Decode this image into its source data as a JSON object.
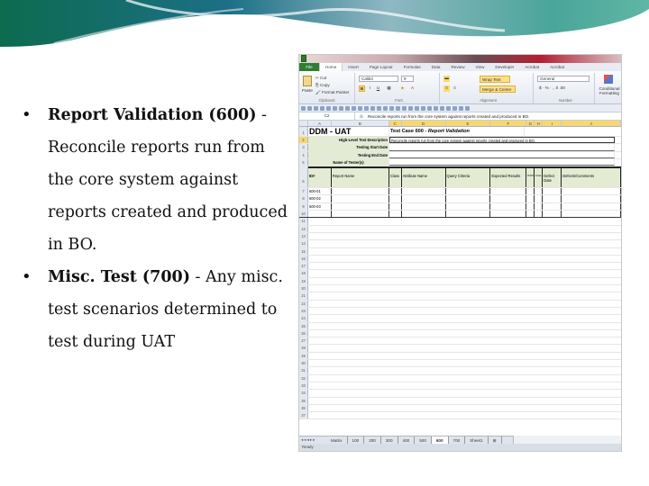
{
  "slide": {
    "bullets": [
      {
        "bold": "Report Validation (600)",
        "text": " - Reconcile reports run from the core system against reports created and produced in BO."
      },
      {
        "bold": "Misc. Test (700)",
        "text": " - Any misc. test scenarios determined to test during UAT"
      }
    ]
  },
  "excel": {
    "ribbon_tabs": [
      "File",
      "Home",
      "Insert",
      "Page Layout",
      "Formulas",
      "Data",
      "Review",
      "View",
      "Developer",
      "Acrobat",
      "Acrobat"
    ],
    "active_tab": "Home",
    "clipboard": {
      "paste": "Paste",
      "cut": "Cut",
      "copy": "Copy",
      "format_painter": "Format Painter",
      "group": "Clipboard"
    },
    "font": {
      "name": "Calibri",
      "size": "9",
      "bold": "B",
      "italic": "I",
      "underline": "U",
      "group": "Font"
    },
    "alignment": {
      "wrap_text": "Wrap Text",
      "merge_center": "Merge & Center",
      "group": "Alignment"
    },
    "number": {
      "format": "General",
      "group": "Number"
    },
    "styles": {
      "conditional_formatting": "Conditional Formatting"
    },
    "name_box": "C2",
    "fx": "fx",
    "formula": "Reconcile reports run from the core system against reports created and produced in BO.",
    "columns": [
      "A",
      "B",
      "C",
      "D",
      "E",
      "F",
      "G",
      "H",
      "I",
      "J"
    ],
    "selected_column": "C",
    "sheet": {
      "title": "DDM - UAT",
      "test_case": "Test Case 600 - ",
      "test_case_italic": "Report Validation",
      "fields": [
        {
          "label": "High-Level Test Description",
          "value": "Reconcile reports run from the core system against reports created and produced in BO."
        },
        {
          "label": "Testing Start Date",
          "value": ""
        },
        {
          "label": "Testing End Date",
          "value": ""
        },
        {
          "label": "Name of Tester(s)",
          "value": ""
        }
      ],
      "headers": [
        "ID#",
        "Report Name",
        "Class",
        "Attribute Name",
        "Query Criteria",
        "Expected Results",
        "PASS",
        "FAIL",
        "Defect Date",
        "Defects/Comments"
      ],
      "ids": [
        "600-01",
        "600-02",
        "600-03"
      ],
      "row_numbers": [
        "1",
        "2",
        "3",
        "4",
        "5",
        "6",
        "7",
        "8",
        "9",
        "10",
        "11",
        "12",
        "13",
        "14",
        "15",
        "16",
        "17",
        "18",
        "19",
        "20",
        "21",
        "22",
        "23",
        "24",
        "25",
        "26",
        "27",
        "28",
        "29",
        "30",
        "31",
        "32",
        "33",
        "34",
        "35",
        "36",
        "37"
      ]
    },
    "sheet_tabs": [
      "Matrix",
      "100",
      "200",
      "300",
      "400",
      "500",
      "600",
      "700",
      "Sheet1"
    ],
    "active_sheet": "600",
    "status": "Ready"
  }
}
